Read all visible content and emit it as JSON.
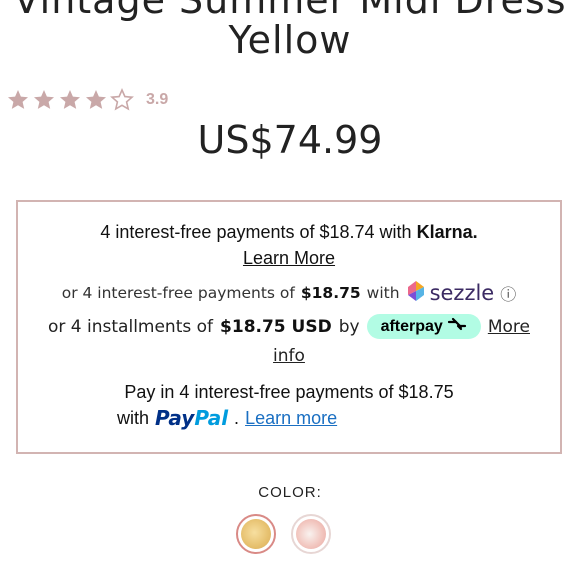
{
  "product": {
    "title_line1": "Vintage Summer Midi Dress",
    "title_line2": "Yellow",
    "rating": {
      "value": "3.9",
      "stars_filled": 4,
      "stars_total": 5
    },
    "price": "US$74.99"
  },
  "payments": {
    "klarna": {
      "text": "4 interest-free payments of $18.74 with",
      "brand": "Klarna.",
      "link": "Learn More"
    },
    "sezzle": {
      "prefix": "or 4 interest-free payments of",
      "amount": "$18.75",
      "with": "with",
      "brand": "sezzle",
      "info": "ⓘ"
    },
    "afterpay": {
      "prefix": "or 4 installments of",
      "amount": "$18.75 USD",
      "by": "by",
      "brand": "afterpay",
      "link_part1": "More",
      "link_part2": "info"
    },
    "paypal": {
      "line1": "Pay in 4 interest-free payments of $18.75",
      "with": "with",
      "brand_pay": "Pay",
      "brand_pal": "Pal",
      "dot": ".",
      "link": "Learn more"
    }
  },
  "color": {
    "label": "COLOR:",
    "swatches": [
      {
        "name": "Yellow",
        "selected": true
      },
      {
        "name": "Pink",
        "selected": false
      }
    ]
  },
  "colors": {
    "star": "#c9a8a8",
    "box_border": "#d2b4b2",
    "afterpay_bg": "#b2fce4",
    "paypal_dark": "#003087",
    "paypal_light": "#009cde",
    "sezzle": "#3b2a63"
  }
}
